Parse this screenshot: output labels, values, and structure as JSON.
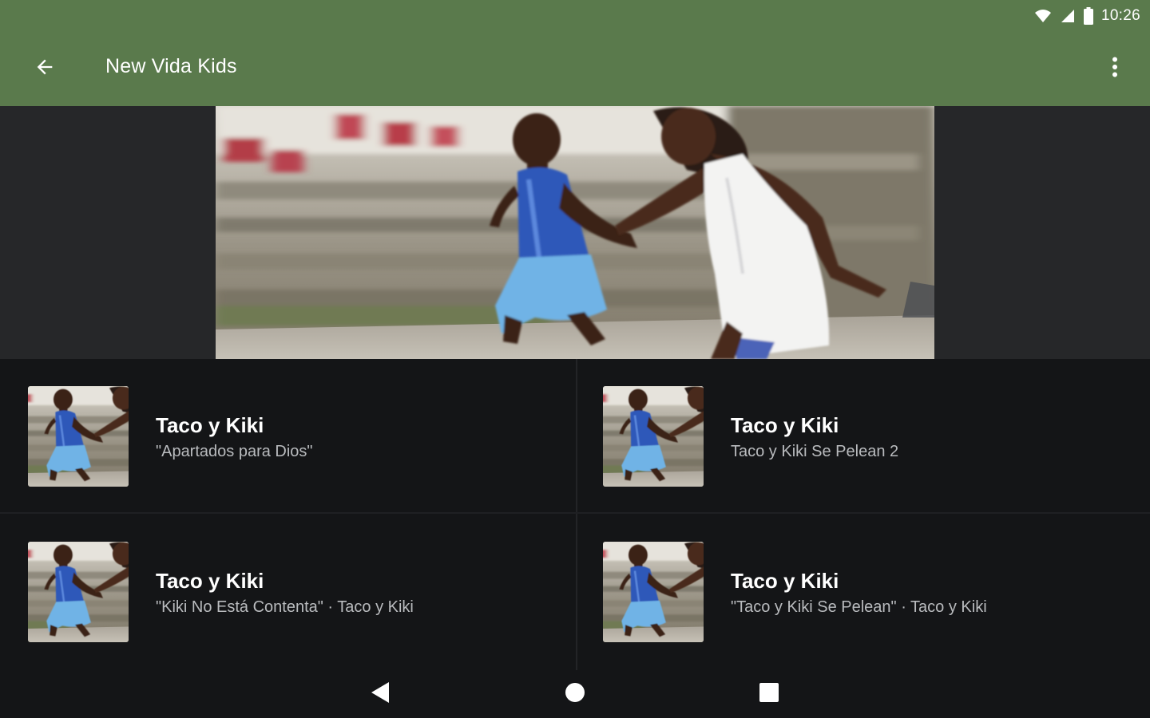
{
  "status_bar": {
    "time": "10:26",
    "icons": [
      "wifi-icon",
      "cell-signal-icon",
      "battery-icon"
    ]
  },
  "app_bar": {
    "title": "New Vida Kids",
    "back_icon": "arrow-back-icon",
    "menu_icon": "more-vert-icon",
    "color": "#5a7a4c"
  },
  "hero": {
    "image": "children-running-photo"
  },
  "episodes": [
    {
      "title": "Taco y Kiki",
      "subtitle": "\"Apartados para Dios\""
    },
    {
      "title": "Taco y Kiki",
      "subtitle": "Taco y Kiki Se Pelean 2"
    },
    {
      "title": "Taco y Kiki",
      "subtitle": "\"Kiki No Está Contenta\" · Taco y Kiki"
    },
    {
      "title": "Taco y Kiki",
      "subtitle": "\"Taco y Kiki Se Pelean\" · Taco y Kiki"
    }
  ],
  "nav_bar": {
    "buttons": [
      "back-triangle-icon",
      "home-circle-icon",
      "recents-square-icon"
    ]
  }
}
